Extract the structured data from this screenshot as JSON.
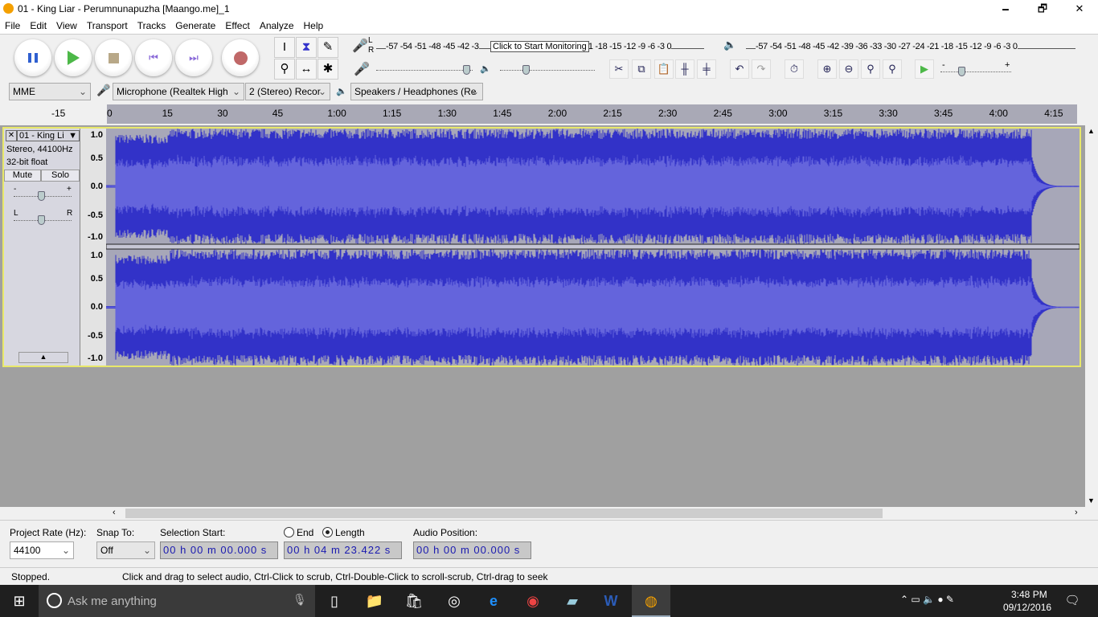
{
  "window": {
    "title": "01 - King Liar - Perumnunapuzha [Maango.me]_1",
    "minimize": "🗕",
    "maximize": "🗗",
    "close": "✕"
  },
  "menu": [
    "File",
    "Edit",
    "View",
    "Transport",
    "Tracks",
    "Generate",
    "Effect",
    "Analyze",
    "Help"
  ],
  "transport": {
    "pause": "pause-icon",
    "play": "play-icon",
    "stop": "stop-icon",
    "skip_start": "skip-start-icon",
    "skip_end": "skip-end-icon",
    "record": "record-icon"
  },
  "tools": {
    "select": "I",
    "envelope": "⧗",
    "draw": "✎",
    "zoom": "⚲",
    "timeshift": "↔",
    "multi": "✱"
  },
  "meters": {
    "rec_labels": "-57 -54 -51 -48 -45 -42 -3",
    "rec_labels_right": "21 -18 -15 -12 -9 -6 -3 0",
    "tooltip": "Click to Start Monitoring",
    "play_labels": "-57 -54 -51 -48 -45 -42 -39 -36 -33 -30 -27 -24 -21 -18 -15 -12 -9 -6 -3 0",
    "L": "L",
    "R": "R"
  },
  "mixer": {
    "minus": "-",
    "plus": "+"
  },
  "devices": {
    "host": "MME",
    "input": "Microphone (Realtek High",
    "channels": "2 (Stereo) Recor",
    "output": "Speakers / Headphones (Re"
  },
  "ruler": {
    "ticks": [
      "-15",
      "0",
      "15",
      "30",
      "45",
      "1:00",
      "1:15",
      "1:30",
      "1:45",
      "2:00",
      "2:15",
      "2:30",
      "2:45",
      "3:00",
      "3:15",
      "3:30",
      "3:45",
      "4:00",
      "4:15"
    ]
  },
  "track": {
    "name": "01 - King Li",
    "close": "✕",
    "info1": "Stereo, 44100Hz",
    "info2": "32-bit float",
    "mute": "Mute",
    "solo": "Solo",
    "gain_minus": "-",
    "gain_plus": "+",
    "pan_l": "L",
    "pan_r": "R",
    "collapse": "▲",
    "scale": [
      "1.0",
      "0.5",
      "0.0",
      "-0.5",
      "-1.0"
    ],
    "wave_color": "#3232c8",
    "wave_rms": "#6464dc"
  },
  "selection": {
    "project_rate_label": "Project Rate (Hz):",
    "project_rate": "44100",
    "snap_label": "Snap To:",
    "snap": "Off",
    "sel_start_label": "Selection Start:",
    "end_label": "End",
    "length_label": "Length",
    "length_selected": true,
    "sel_start": "00 h 00 m 00.000 s",
    "length": "00 h 04 m 23.422 s",
    "audio_pos_label": "Audio Position:",
    "audio_pos": "00 h 00 m 00.000 s"
  },
  "status": {
    "state": "Stopped.",
    "hint": "Click and drag to select audio, Ctrl-Click to scrub, Ctrl-Double-Click to scroll-scrub, Ctrl-drag to seek"
  },
  "taskbar": {
    "search": "Ask me anything",
    "time": "3:48 PM",
    "date": "09/12/2016"
  }
}
